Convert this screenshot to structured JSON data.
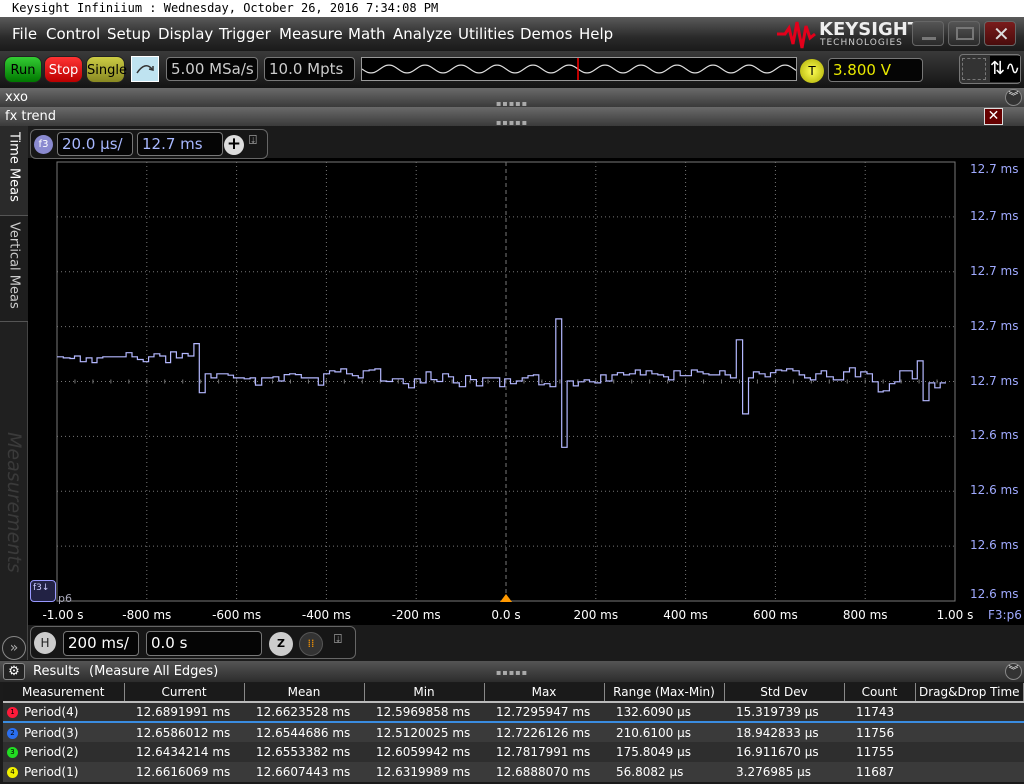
{
  "title": "Keysight Infiniium : Wednesday, October 26, 2016 7:34:08 PM",
  "menu": [
    "File",
    "Control",
    "Setup",
    "Display",
    "Trigger",
    "Measure",
    "Math",
    "Analyze",
    "Utilities",
    "Demos",
    "Help"
  ],
  "logo": {
    "brand": "KEYSIGHT",
    "sub": "TECHNOLOGIES",
    "color": "#e3001b"
  },
  "toolbar": {
    "run": "Run",
    "stop": "Stop",
    "single": "Single",
    "sample_rate": "5.00 MSa/s",
    "memory_depth": "10.0 Mpts",
    "trigger_badge": "T",
    "trigger_level": "3.800 V"
  },
  "panels": {
    "xxo": "xxo",
    "fx_trend": "fx trend"
  },
  "side_tabs": {
    "time_meas": "Time Meas",
    "vertical_meas": "Vertical Meas",
    "measurements": "Measurements"
  },
  "function_ctrl": {
    "badge": "f3",
    "scale": "20.0 µs/",
    "offset": "12.7 ms"
  },
  "horizontal_ctrl": {
    "badge": "H",
    "scale": "200 ms/",
    "position": "0.0 s",
    "zoom_badge": "Z"
  },
  "chart_data": {
    "type": "line",
    "trace_color": "#b4b8ff",
    "xlim": [
      -1000,
      1000
    ],
    "ylim": [
      12.62,
      12.78
    ],
    "grid": true,
    "x_tick_labels": [
      "-1.00 s",
      "-800 ms",
      "-600 ms",
      "-400 ms",
      "-200 ms",
      "0.0 s",
      "200 ms",
      "400 ms",
      "600 ms",
      "800 ms",
      "1.00 s"
    ],
    "y_tick_labels": [
      "12.7 ms",
      "12.7 ms",
      "12.7 ms",
      "12.7 ms",
      "12.7 ms",
      "12.6 ms",
      "12.6 ms",
      "12.6 ms",
      "12.6 ms"
    ],
    "marker_label": "p6",
    "source_label": "F3:p6",
    "step_points": [
      [
        -1000,
        12.709
      ],
      [
        -986,
        12.7086
      ],
      [
        -971,
        12.7084
      ],
      [
        -961,
        12.7093
      ],
      [
        -948,
        12.7072
      ],
      [
        -935,
        12.7086
      ],
      [
        -922,
        12.7069
      ],
      [
        -911,
        12.7086
      ],
      [
        -898,
        12.709
      ],
      [
        -846,
        12.7105
      ],
      [
        -833,
        12.709
      ],
      [
        -821,
        12.708
      ],
      [
        -808,
        12.7072
      ],
      [
        -796,
        12.709
      ],
      [
        -784,
        12.7101
      ],
      [
        -771,
        12.7093
      ],
      [
        -758,
        12.7069
      ],
      [
        -747,
        12.7108
      ],
      [
        -734,
        12.7086
      ],
      [
        -721,
        12.7102
      ],
      [
        -708,
        12.7093
      ],
      [
        -695,
        12.7138
      ],
      [
        -683,
        12.6959
      ],
      [
        -670,
        12.7028
      ],
      [
        -657,
        12.7013
      ],
      [
        -644,
        12.7028
      ],
      [
        -619,
        12.7023
      ],
      [
        -607,
        12.7013
      ],
      [
        -583,
        12.701
      ],
      [
        -570,
        12.7013
      ],
      [
        -558,
        12.6987
      ],
      [
        -544,
        12.7013
      ],
      [
        -519,
        12.7017
      ],
      [
        -506,
        12.7002
      ],
      [
        -494,
        12.7025
      ],
      [
        -482,
        12.7028
      ],
      [
        -469,
        12.7025
      ],
      [
        -456,
        12.7013
      ],
      [
        -418,
        12.6987
      ],
      [
        -406,
        12.7028
      ],
      [
        -393,
        12.7039
      ],
      [
        -381,
        12.7035
      ],
      [
        -368,
        12.7046
      ],
      [
        -355,
        12.7028
      ],
      [
        -342,
        12.7021
      ],
      [
        -329,
        12.7013
      ],
      [
        -318,
        12.7039
      ],
      [
        -305,
        12.7042
      ],
      [
        -292,
        12.7046
      ],
      [
        -279,
        12.7002
      ],
      [
        -266,
        12.7
      ],
      [
        -253,
        12.701
      ],
      [
        -229,
        12.6992
      ],
      [
        -217,
        12.6977
      ],
      [
        -204,
        12.701
      ],
      [
        -191,
        12.6995
      ],
      [
        -178,
        12.7035
      ],
      [
        -167,
        12.7007
      ],
      [
        -154,
        12.7
      ],
      [
        -141,
        12.7028
      ],
      [
        -128,
        12.7017
      ],
      [
        -117,
        12.6995
      ],
      [
        -104,
        12.6981
      ],
      [
        -90,
        12.7021
      ],
      [
        -79,
        12.7007
      ],
      [
        -66,
        12.6984
      ],
      [
        -52,
        12.7013
      ],
      [
        -14,
        12.6981
      ],
      [
        -3,
        12.701
      ],
      [
        10,
        12.6992
      ],
      [
        23,
        12.7002
      ],
      [
        36,
        12.7013
      ],
      [
        49,
        12.7021
      ],
      [
        61,
        12.7024
      ],
      [
        73,
        12.6988
      ],
      [
        85,
        12.6992
      ],
      [
        98,
        12.6981
      ],
      [
        111,
        12.7228
      ],
      [
        124,
        12.676
      ],
      [
        136,
        12.7002
      ],
      [
        150,
        12.6984
      ],
      [
        161,
        12.6999
      ],
      [
        174,
        12.7006
      ],
      [
        186,
        12.6999
      ],
      [
        198,
        12.6995
      ],
      [
        211,
        12.7024
      ],
      [
        223,
        12.7002
      ],
      [
        236,
        12.7024
      ],
      [
        248,
        12.7032
      ],
      [
        262,
        12.7024
      ],
      [
        275,
        12.7028
      ],
      [
        288,
        12.7042
      ],
      [
        299,
        12.7024
      ],
      [
        312,
        12.7039
      ],
      [
        325,
        12.7028
      ],
      [
        338,
        12.7024
      ],
      [
        351,
        12.7017
      ],
      [
        362,
        12.7006
      ],
      [
        374,
        12.7039
      ],
      [
        388,
        12.7021
      ],
      [
        413,
        12.7042
      ],
      [
        426,
        12.7035
      ],
      [
        439,
        12.7028
      ],
      [
        452,
        12.7024
      ],
      [
        476,
        12.7039
      ],
      [
        488,
        12.7024
      ],
      [
        500,
        12.7013
      ],
      [
        513,
        12.7152
      ],
      [
        527,
        12.6882
      ],
      [
        540,
        12.7013
      ],
      [
        551,
        12.7035
      ],
      [
        564,
        12.7028
      ],
      [
        577,
        12.7017
      ],
      [
        589,
        12.7032
      ],
      [
        601,
        12.7042
      ],
      [
        614,
        12.7039
      ],
      [
        625,
        12.7046
      ],
      [
        639,
        12.7039
      ],
      [
        653,
        12.7024
      ],
      [
        665,
        12.7013
      ],
      [
        678,
        12.7006
      ],
      [
        690,
        12.7028
      ],
      [
        702,
        12.7039
      ],
      [
        714,
        12.7017
      ],
      [
        729,
        12.7006
      ],
      [
        752,
        12.7035
      ],
      [
        765,
        12.705
      ],
      [
        778,
        12.7017
      ],
      [
        790,
        12.7035
      ],
      [
        804,
        12.7028
      ],
      [
        816,
        12.6999
      ],
      [
        829,
        12.6962
      ],
      [
        840,
        12.6966
      ],
      [
        854,
        12.6992
      ],
      [
        866,
        12.6999
      ],
      [
        877,
        12.7039
      ],
      [
        905,
        12.701
      ],
      [
        916,
        12.7075
      ],
      [
        929,
        12.693
      ],
      [
        942,
        12.6995
      ],
      [
        955,
        12.6977
      ],
      [
        967,
        12.6995
      ],
      [
        980,
        12.6995
      ]
    ]
  },
  "results": {
    "title": "Results",
    "subtitle": "(Measure All Edges)",
    "columns": [
      "Measurement",
      "Current",
      "Mean",
      "Min",
      "Max",
      "Range (Max-Min)",
      "Std Dev",
      "Count",
      "Drag&Drop Time"
    ],
    "rows": [
      {
        "n": "1",
        "color": "#ff1a3a",
        "cells": [
          "Period(4)",
          "12.6891991 ms",
          "12.6623528 ms",
          "12.5969858 ms",
          "12.7295947 ms",
          "132.6090 µs",
          "15.319739 µs",
          "11743",
          ""
        ]
      },
      {
        "n": "2",
        "color": "#2a6ff0",
        "cells": [
          "Period(3)",
          "12.6586012 ms",
          "12.6544686 ms",
          "12.5120025 ms",
          "12.7226126 ms",
          "210.6100 µs",
          "18.942833 µs",
          "11756",
          ""
        ]
      },
      {
        "n": "3",
        "color": "#22dd22",
        "cells": [
          "Period(2)",
          "12.6434214 ms",
          "12.6553382 ms",
          "12.6059942 ms",
          "12.7817991 ms",
          "175.8049 µs",
          "16.911670 µs",
          "11755",
          ""
        ]
      },
      {
        "n": "4",
        "color": "#f0f000",
        "cells": [
          "Period(1)",
          "12.6616069 ms",
          "12.6607443 ms",
          "12.6319989 ms",
          "12.6888070 ms",
          "56.8082 µs",
          "3.276985 µs",
          "11687",
          ""
        ]
      }
    ]
  }
}
